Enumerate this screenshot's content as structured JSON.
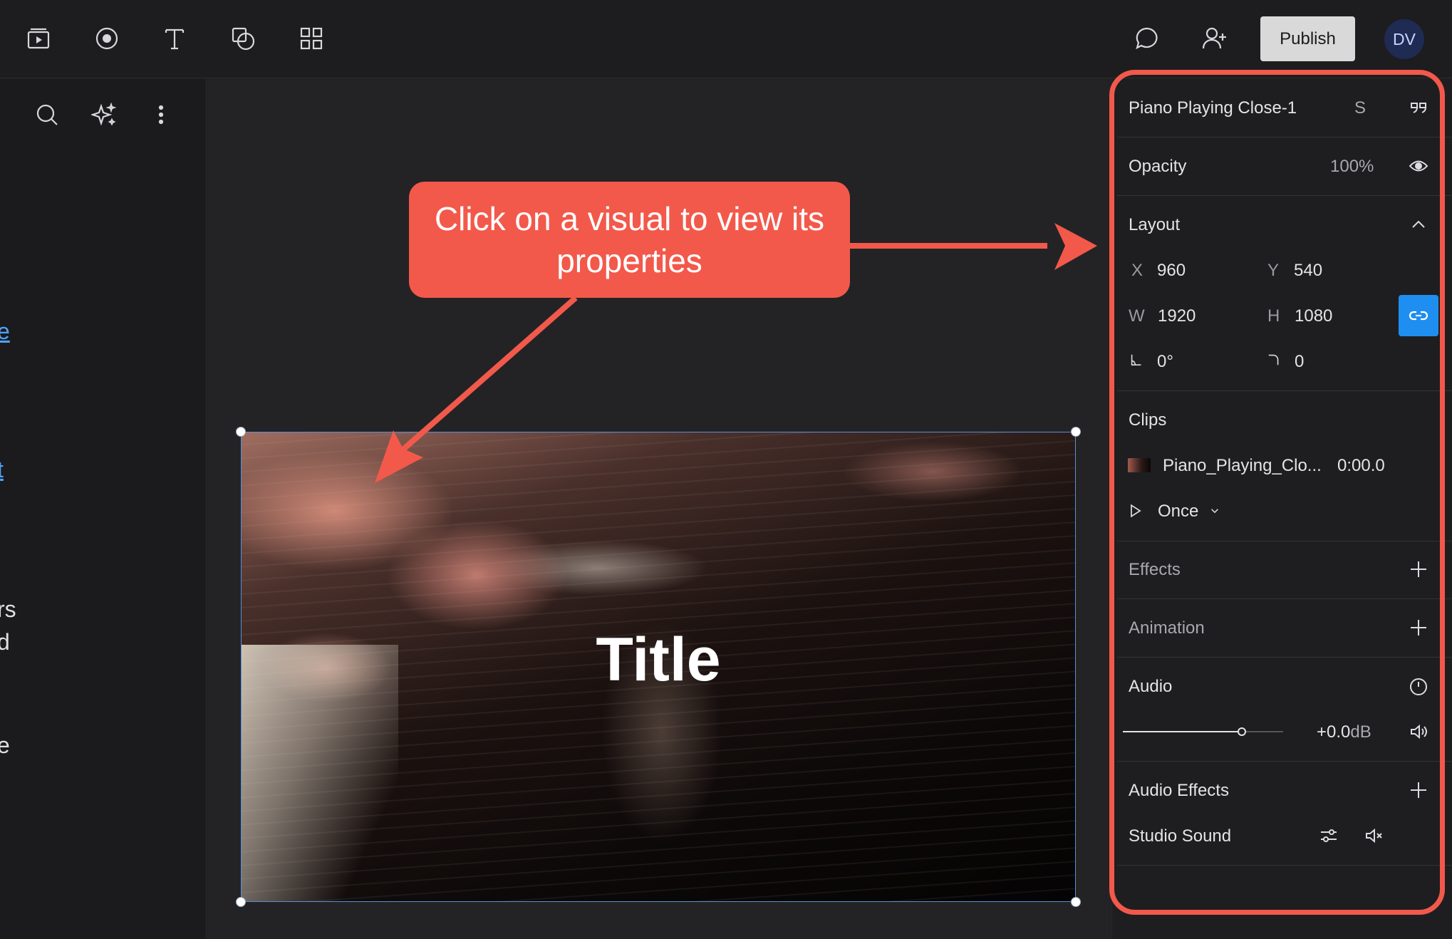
{
  "toolbar": {
    "icons": [
      "media-icon",
      "record-icon",
      "text-icon",
      "shapes-icon",
      "grid-icon"
    ],
    "right_icons": [
      "comment-icon",
      "add-user-icon"
    ],
    "publish_label": "Publish",
    "avatar_initials": "DV"
  },
  "left_panel": {
    "icons": [
      "search-icon",
      "sparkle-icon",
      "more-icon"
    ],
    "fragments": [
      "e",
      "t",
      "rs",
      "d",
      "e"
    ]
  },
  "canvas": {
    "title_text": "Title"
  },
  "callout": {
    "text": "Click on a visual to view its properties"
  },
  "properties": {
    "clip_name": "Piano Playing Close-1",
    "shortcut": "S",
    "opacity_label": "Opacity",
    "opacity_value": "100%",
    "layout_label": "Layout",
    "x_label": "X",
    "x_value": "960",
    "y_label": "Y",
    "y_value": "540",
    "w_label": "W",
    "w_value": "1920",
    "h_label": "H",
    "h_value": "1080",
    "rotation_value": "0°",
    "corner_value": "0",
    "clips_label": "Clips",
    "clip_file": "Piano_Playing_Clo...",
    "clip_time": "0:00.0",
    "loop_mode": "Once",
    "effects_label": "Effects",
    "animation_label": "Animation",
    "audio_label": "Audio",
    "audio_gain": "+0.0",
    "audio_unit": "dB",
    "audio_level": 0.74,
    "audio_effects_label": "Audio Effects",
    "studio_sound_label": "Studio Sound"
  },
  "colors": {
    "accent_callout": "#f2594b",
    "link_blue": "#1e8ff0",
    "selection_blue": "#5a8fd8"
  }
}
